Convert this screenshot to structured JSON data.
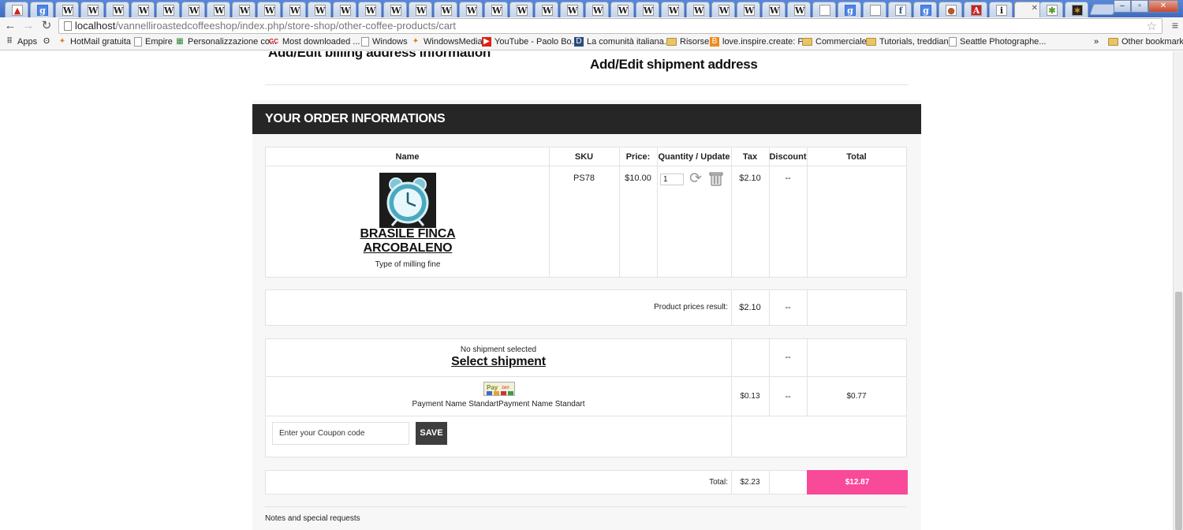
{
  "browser": {
    "tab_favicons": [
      "pdf",
      "G",
      "W",
      "W",
      "W",
      "W",
      "W",
      "W",
      "W",
      "W",
      "W",
      "W",
      "W",
      "W",
      "W",
      "W",
      "W",
      "W",
      "W",
      "W",
      "W",
      "W",
      "W",
      "W",
      "W",
      "W",
      "W",
      "W",
      "W",
      "W",
      "W",
      "W",
      "page",
      "G",
      "page",
      "f",
      "G",
      "moz",
      "A",
      "i",
      "active",
      "joomla",
      "fx"
    ],
    "url_prefix": "localhost",
    "url_path": "/vannelliroastedcoffeeshop/index.php/store-shop/other-coffee-products/cart",
    "bookmarks": [
      {
        "icon": "grid",
        "label": "Apps"
      },
      {
        "icon": "hm",
        "label": ""
      },
      {
        "icon": "hotmail",
        "label": "HotMail gratuita"
      },
      {
        "icon": "page",
        "label": "Empire"
      },
      {
        "icon": "ms",
        "label": "Personalizzazione co..."
      },
      {
        "icon": "gc",
        "label": "Most downloaded ..."
      },
      {
        "icon": "page",
        "label": "Windows"
      },
      {
        "icon": "wm",
        "label": "WindowsMedia"
      },
      {
        "icon": "yt",
        "label": "YouTube - Paolo Bo..."
      },
      {
        "icon": "d",
        "label": "La comunità italiana..."
      },
      {
        "icon": "folder",
        "label": "Risorse"
      },
      {
        "icon": "blogger",
        "label": "love.inspire.create: F..."
      },
      {
        "icon": "folder",
        "label": "Commerciale"
      },
      {
        "icon": "folder",
        "label": "Tutorials, treddiani"
      },
      {
        "icon": "page",
        "label": "Seattle Photographe..."
      }
    ],
    "overflow": "»",
    "other_bookmarks": "Other bookmarks"
  },
  "page": {
    "billing_title": "Add/Edit billing address information",
    "shipment_title": "Add/Edit shipment address",
    "order_header": "YOUR ORDER INFORMATIONS",
    "columns": [
      "Name",
      "SKU",
      "Price:",
      "Quantity / Update",
      "Tax",
      "Discount",
      "Total"
    ],
    "product": {
      "name": "BRASILE FINCA ARCOBALENO",
      "description": "Type of milling fine",
      "sku": "PS78",
      "price": "$10.00",
      "quantity": "1",
      "tax": "$2.10",
      "discount": "--",
      "total": ""
    },
    "product_prices_label": "Product prices result:",
    "product_prices_tax": "$2.10",
    "product_prices_discount": "--",
    "no_shipment": "No shipment selected",
    "select_shipment": "Select shipment",
    "shipment_discount": "--",
    "payment_name": "Payment Name StandartPayment Name Standart",
    "payment_tax": "$0.13",
    "payment_discount": "--",
    "payment_total": "$0.77",
    "coupon_placeholder": "Enter your Coupon code",
    "save_label": "SAVE",
    "total_label": "Total:",
    "total_tax": "$2.23",
    "grand_total": "$12.87",
    "notes_label": "Notes and special requests"
  },
  "colors": {
    "header_bg": "#262626",
    "grand_total_bg": "#f94a9a",
    "save_bg": "#3e3e3e"
  }
}
